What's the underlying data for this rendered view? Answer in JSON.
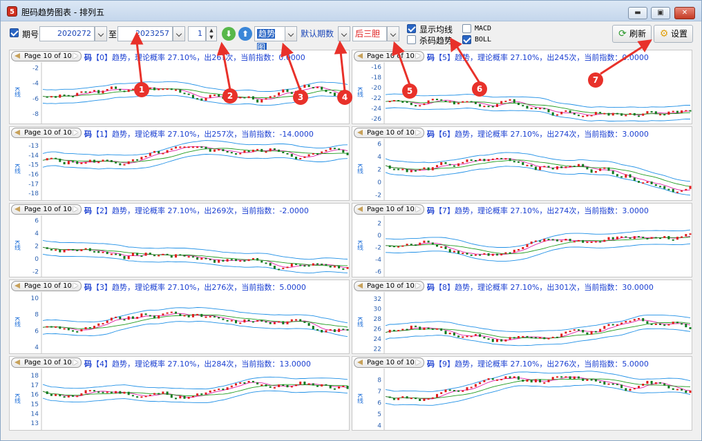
{
  "window": {
    "title": "胆码趋势图表 - 排列五",
    "app_icon_glyph": "5",
    "controls": {
      "minimize": "▬",
      "maximize": "▣",
      "close": "✕"
    }
  },
  "toolbar": {
    "period_label": "期号",
    "period_checked": true,
    "from_value": "2020272",
    "to_label": "至",
    "to_value": "2023257",
    "step_value": "1",
    "spin_up": "▲",
    "spin_down": "▼",
    "down_glyph": "⬇",
    "up_glyph": "⬆",
    "chart_type": "趋势图",
    "period_mode": "默认期数",
    "position": "后三胆",
    "show_ma_label": "显示均线",
    "show_ma_checked": true,
    "kill_trend_label": "杀码趋势",
    "kill_trend_checked": false,
    "macd_label": "MACD",
    "macd_checked": false,
    "boll_label": "BOLL",
    "boll_checked": true,
    "refresh_label": "刷新",
    "refresh_glyph": "⟳",
    "settings_label": "设置",
    "settings_glyph": "⚙",
    "colors": {
      "accent": "#2a66c4",
      "field_text": "#1c47b8"
    }
  },
  "charts": {
    "pager": "Page 10 of 10",
    "prefix": "码",
    "y_axis_label": "K线",
    "colors": {
      "title": "#1a3fd1",
      "rise": "#e01b1b",
      "fall": "#0f7a1e",
      "boll": "#1e8fe6",
      "ma_fast": "#e020a6",
      "ma_slow": "#1e9a1e"
    },
    "panels": [
      {
        "id": "0",
        "title_a": "【0】趋势，理论概率 27.10%，出",
        "title_b": "26?次，当前指数：",
        "title_c": "0.0000",
        "ticks": [
          "-2",
          "-4",
          "-6",
          "-8"
        ],
        "ylim": [
          -9,
          -1.5
        ]
      },
      {
        "id": "5",
        "title_a": "【5】趋势，理论概率 27.10%，出245次，当前指数：",
        "title_b": "",
        "title_c": "0.0000",
        "ticks": [
          "-16",
          "-18",
          "-20",
          "-22",
          "-24",
          "-26"
        ],
        "ylim": [
          -26.5,
          -15.5
        ]
      },
      {
        "id": "1",
        "title_a": "【1】趋势，理论概率 27.10%，出257次，当前指数：-14.0000",
        "title_b": "",
        "title_c": "",
        "ticks": [
          "-13",
          "-14",
          "-15",
          "-16",
          "-17",
          "-18"
        ],
        "ylim": [
          -18.5,
          -12.5
        ]
      },
      {
        "id": "6",
        "title_a": "【6】趋势，理论概率 27.10%，出274次，当前指数：3.0000",
        "title_b": "",
        "title_c": "",
        "ticks": [
          "6",
          "4",
          "2",
          "0",
          "-2"
        ],
        "ylim": [
          -2.5,
          6.5
        ]
      },
      {
        "id": "2",
        "title_a": "【2】趋势，理论概率 27.10%，出269次，当前指数：-2.0000",
        "title_b": "",
        "title_c": "",
        "ticks": [
          "6",
          "4",
          "2",
          "0",
          "-2"
        ],
        "ylim": [
          -2.5,
          6.5
        ]
      },
      {
        "id": "7",
        "title_a": "【7】趋势，理论概率 27.10%，出274次，当前指数：3.0000",
        "title_b": "",
        "title_c": "",
        "ticks": [
          "2",
          "0",
          "-2",
          "-4",
          "-6"
        ],
        "ylim": [
          -6.5,
          3
        ]
      },
      {
        "id": "3",
        "title_a": "【3】趋势，理论概率 27.10%，出276次，当前指数：5.0000",
        "title_b": "",
        "title_c": "",
        "ticks": [
          "10",
          "8",
          "6",
          "4"
        ],
        "ylim": [
          3.5,
          10.5
        ]
      },
      {
        "id": "8",
        "title_a": "【8】趋势，理论概率 27.10%，出301次，当前指数：30.0000",
        "title_b": "",
        "title_c": "",
        "ticks": [
          "32",
          "30",
          "28",
          "26",
          "24",
          "22"
        ],
        "ylim": [
          21.5,
          33
        ]
      },
      {
        "id": "4",
        "title_a": "【4】趋势，理论概率 27.10%，出284次，当前指数：13.0000",
        "title_b": "",
        "title_c": "",
        "ticks": [
          "18",
          "17",
          "16",
          "15",
          "14",
          "13"
        ],
        "ylim": [
          12.5,
          18.5
        ]
      },
      {
        "id": "9",
        "title_a": "【9】趋势，理论概率 27.10%，出276次，当前指数：5.0000",
        "title_b": "",
        "title_c": "",
        "ticks": [
          "8",
          "7",
          "6",
          "5",
          "4"
        ],
        "ylim": [
          3.8,
          8.8
        ]
      }
    ]
  },
  "annotations": [
    "1",
    "2",
    "3",
    "4",
    "5",
    "6",
    "7"
  ]
}
